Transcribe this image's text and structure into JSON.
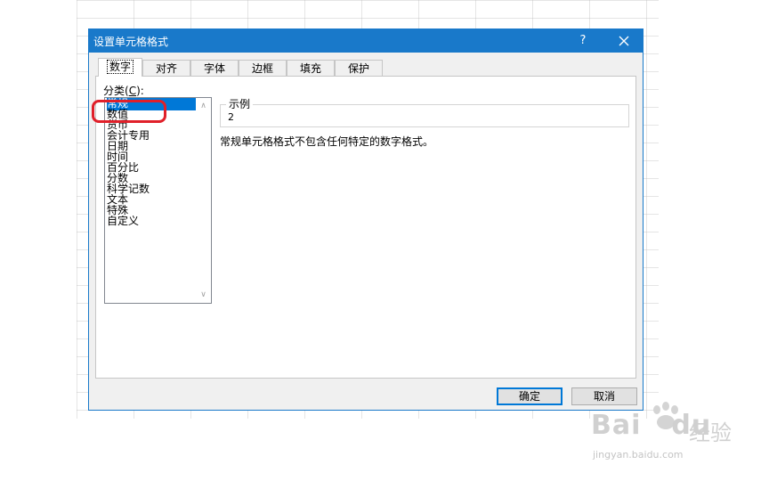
{
  "dialog": {
    "title": "设置单元格格式",
    "help_label": "?",
    "close_icon": "close-icon",
    "accent_color": "#1979ca"
  },
  "tabs": [
    {
      "label": "数字",
      "active": true
    },
    {
      "label": "对齐",
      "active": false
    },
    {
      "label": "字体",
      "active": false
    },
    {
      "label": "边框",
      "active": false
    },
    {
      "label": "填充",
      "active": false
    },
    {
      "label": "保护",
      "active": false
    }
  ],
  "category": {
    "label_prefix": "分类(",
    "label_key": "C",
    "label_suffix": "):",
    "items": [
      "常规",
      "数值",
      "货币",
      "会计专用",
      "日期",
      "时间",
      "百分比",
      "分数",
      "科学记数",
      "文本",
      "特殊",
      "自定义"
    ],
    "selected": "常规"
  },
  "sample": {
    "label": "示例",
    "value": "2"
  },
  "description": "常规单元格格式不包含任何特定的数字格式。",
  "buttons": {
    "ok": "确定",
    "cancel": "取消"
  },
  "annotation": {
    "color": "#e0202a"
  },
  "watermark": {
    "logo": "Bai",
    "logo_suffix": "du",
    "sub": "经验",
    "url": "jingyan.baidu.com"
  }
}
